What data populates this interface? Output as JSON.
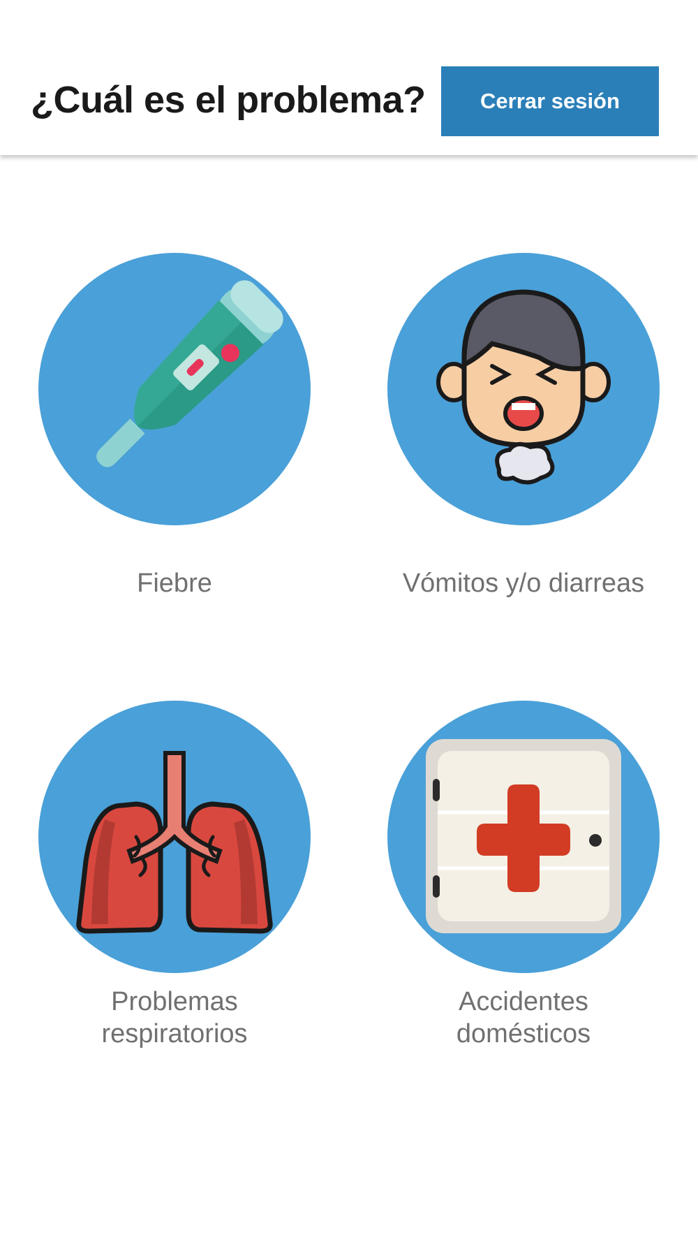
{
  "header": {
    "title": "¿Cuál es el problema?",
    "logout_label": "Cerrar sesión"
  },
  "options": [
    {
      "label": "Fiebre",
      "icon": "thermometer-icon"
    },
    {
      "label": "Vómitos y/o diarreas",
      "icon": "vomiting-face-icon"
    },
    {
      "label": "Problemas respiratorios",
      "icon": "lungs-icon"
    },
    {
      "label": "Accidentes domésticos",
      "icon": "first-aid-kit-icon"
    }
  ],
  "colors": {
    "accent": "#2a7fb8",
    "circle": "#4aa0d8",
    "label": "#707070"
  }
}
